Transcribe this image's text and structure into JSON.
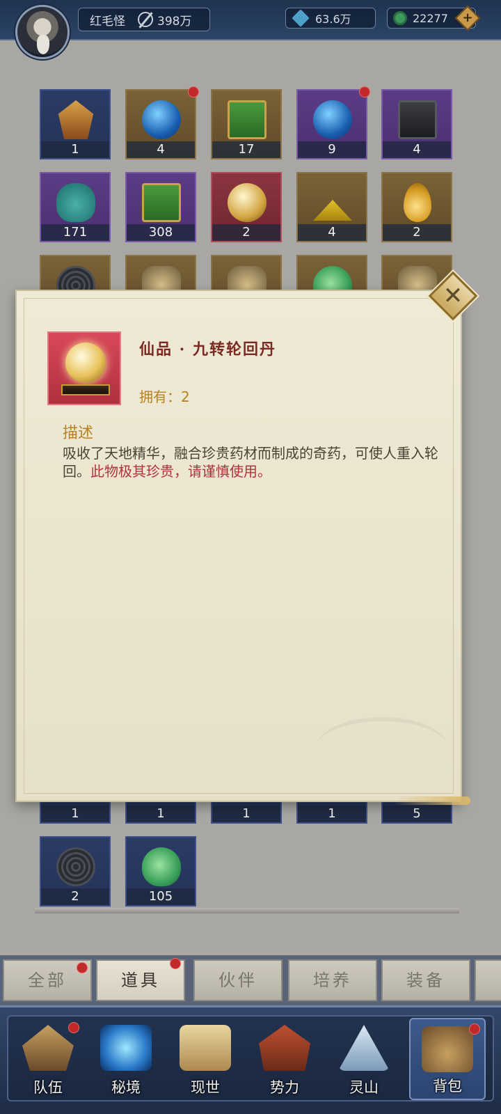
{
  "header": {
    "player_name": "红毛怪",
    "combat_power": "398万",
    "spirit_stones": "63.6万",
    "coins": "22277",
    "plus_label": "+"
  },
  "inventory": {
    "row1": [
      {
        "count": "1",
        "icon": "talisman-icon",
        "color": "blue"
      },
      {
        "count": "4",
        "icon": "fish-orb-icon",
        "color": "gold",
        "badge": true
      },
      {
        "count": "17",
        "icon": "jade-chest-icon",
        "color": "gold"
      },
      {
        "count": "9",
        "icon": "fish-orb-icon",
        "color": "purple",
        "badge": true
      },
      {
        "count": "4",
        "icon": "dark-chest-icon",
        "color": "purple"
      }
    ],
    "row2": [
      {
        "count": "171",
        "icon": "spirit-pouch-icon",
        "color": "purple"
      },
      {
        "count": "308",
        "icon": "jade-chest-icon",
        "color": "purple"
      },
      {
        "count": "2",
        "icon": "golden-pill-icon",
        "color": "red"
      },
      {
        "count": "4",
        "icon": "yellow-powder-icon",
        "color": "gold"
      },
      {
        "count": "2",
        "icon": "amber-drop-icon",
        "color": "gold"
      }
    ],
    "row_hidden_bottom": [
      {
        "count": "1"
      },
      {
        "count": "1"
      },
      {
        "count": "1"
      },
      {
        "count": "1"
      },
      {
        "count": "5"
      }
    ],
    "row_last": [
      {
        "count": "2",
        "icon": "black-disc-icon",
        "color": "blue"
      },
      {
        "count": "105",
        "icon": "jade-leaf-icon",
        "color": "blue"
      }
    ]
  },
  "detail": {
    "title": "仙品 · 九转轮回丹",
    "owned_label": "拥有：",
    "owned_value": "2",
    "desc_label": "描述",
    "desc_text": "吸收了天地精华，融合珍贵药材而制成的奇药，可使人重入轮回。",
    "desc_warning": "此物极其珍贵，请谨慎使用。",
    "close_symbol": "✕"
  },
  "tabs": [
    {
      "label": "全部",
      "badge": true
    },
    {
      "label": "道具",
      "badge": true,
      "active": true
    },
    {
      "label": "伙伴"
    },
    {
      "label": "培养"
    },
    {
      "label": "装备"
    }
  ],
  "nav": [
    {
      "label": "队伍",
      "badge": true
    },
    {
      "label": "秘境"
    },
    {
      "label": "现世"
    },
    {
      "label": "势力"
    },
    {
      "label": "灵山"
    },
    {
      "label": "背包",
      "badge": true,
      "active": true
    }
  ]
}
